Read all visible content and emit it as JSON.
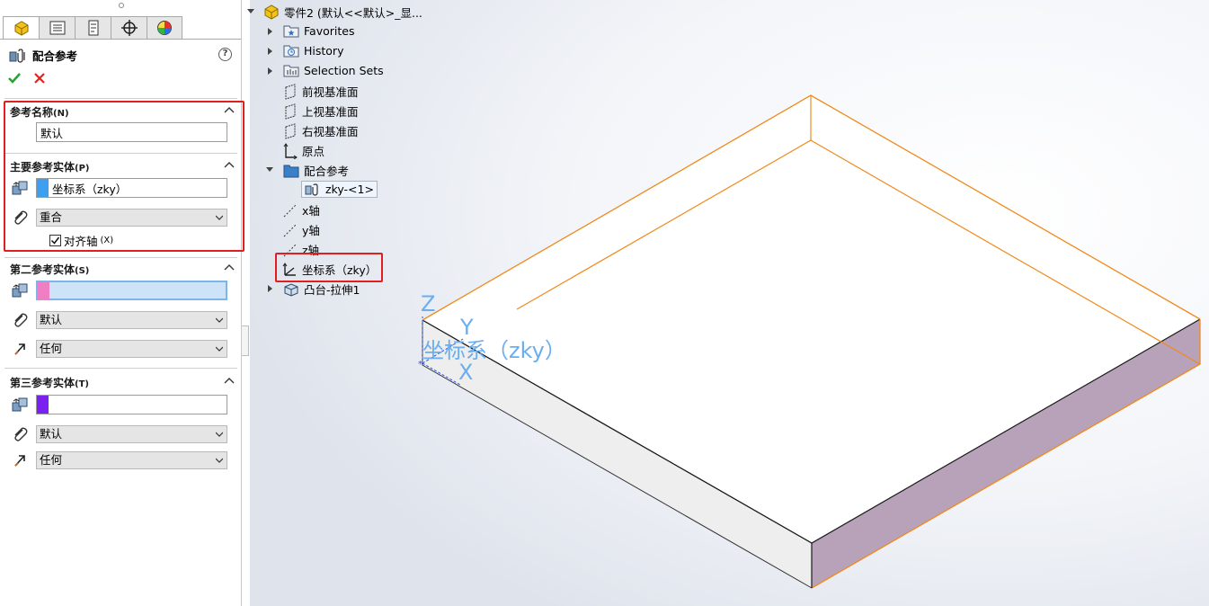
{
  "panel": {
    "title": "配合参考",
    "help": "?",
    "group1": {
      "title": "参考名称",
      "key": "(N)",
      "name_value": "默认"
    },
    "group2": {
      "title": "主要参考实体",
      "key": "(P)",
      "entity": "坐标系（zky）",
      "mate_type": "重合",
      "align_axes": "对齐轴",
      "align_key": "(X)",
      "color": "#3e9ff0"
    },
    "group3": {
      "title": "第二参考实体",
      "key": "(S)",
      "mate_type": "默认",
      "alignment": "任何",
      "color": "#f07ec2"
    },
    "group4": {
      "title": "第三参考实体",
      "key": "(T)",
      "mate_type": "默认",
      "alignment": "任何",
      "color": "#7a21f0"
    }
  },
  "tree": {
    "root": "零件2 (默认<<默认>_显...",
    "favorites": "Favorites",
    "history": "History",
    "selection_sets": "Selection Sets",
    "front_plane": "前视基准面",
    "top_plane": "上视基准面",
    "right_plane": "右视基准面",
    "origin": "原点",
    "mate_ref_folder": "配合参考",
    "mate_ref_item": "zky-<1>",
    "x_axis": "x轴",
    "y_axis": "y轴",
    "z_axis": "z轴",
    "coord_sys": "坐标系（zky）",
    "boss_extrude": "凸台-拉伸1"
  },
  "viewport": {
    "triad_z": "Z",
    "triad_y": "Y",
    "triad_x": "X",
    "coord_label": "坐标系（zky）",
    "edge_color": "#f08a1c",
    "side_face_color": "#b8a2b9"
  }
}
